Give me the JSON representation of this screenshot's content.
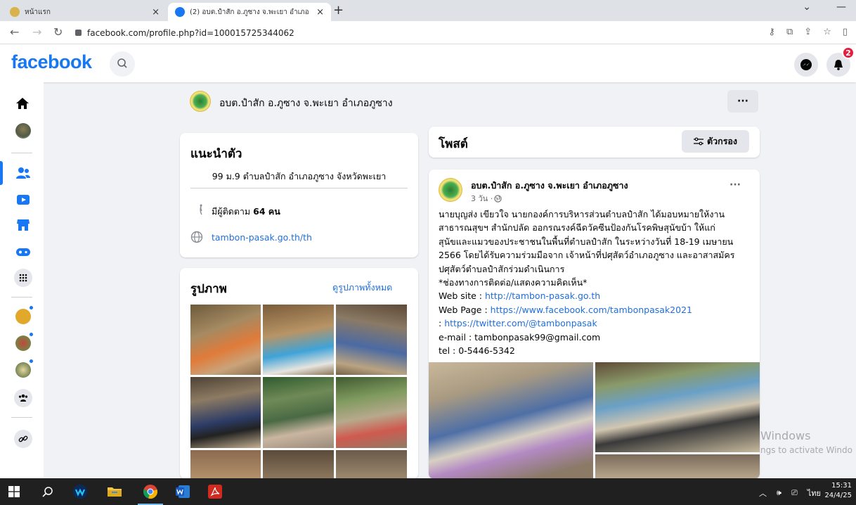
{
  "browser": {
    "tabs": [
      {
        "title": "หน้าแรก",
        "active": false,
        "favicon_color": "#d9b24c"
      },
      {
        "title": "(2) อบต.ปำสัก อ.ภูซาง จ.พะเยา อำเภอ",
        "active": true,
        "favicon_color": "#1877f2"
      }
    ],
    "new_tab": "+",
    "tab_close": "×",
    "url": "facebook.com/profile.php?id=100015725344062",
    "window_controls": [
      "⌄",
      "—"
    ]
  },
  "facebook": {
    "logo": "facebook",
    "notification_count": "2",
    "page_name": "อบต.ปำสัก อ.ภูซาง จ.พะเยา อำเภอภูซาง",
    "more_dots": "···",
    "intro": {
      "title": "แนะนำตัว",
      "address": "99 ม.9 ตำบลปำสัก อำเภอภูซาง จังหวัดพะเยา",
      "followers_prefix": "มีผู้ติดตาม",
      "followers_count": "64 คน",
      "website": "tambon-pasak.go.th/th"
    },
    "photos": {
      "title": "รูปภาพ",
      "see_all": "ดูรูปภาพทั้งหมด"
    },
    "posts": {
      "title": "โพสต์",
      "filter_label": "ตัวกรอง"
    },
    "post": {
      "author": "อบต.ปำสัก อ.ภูซาง จ.พะเยา อำเภอภูซาง",
      "time": "3 วัน ·",
      "lines": [
        "นายบุญส่ง เขียวใจ นายกองค์การบริหารส่วนตำบลปำสัก ได้มอบหมายให้งาน",
        "สาธารณสุขฯ สำนักปลัด ออกรณรงค์ฉีดวัคซีนป้องกันโรคพิษสุนัขบ้า ให้แก่",
        "สุนัขและแมวของประชาชนในพื้นที่ตำบลปำสัก ในระหว่างวันที่ 18-19 เมษายน",
        "2566 โดยได้รับความร่วมมือจาก เจ้าหน้าที่ปศุสัตว์อำเภอภูซาง และอาสาสมัคร",
        "ปศุสัตว์ตำบลปำสักร่วมดำเนินการ",
        "*ช่องทางการติดต่อ/แสดงความคิดเห็น*"
      ],
      "website_label": "Web site : ",
      "website_link": "http://tambon-pasak.go.th",
      "webpage_label": "Web Page : ",
      "webpage_link": "https://www.facebook.com/tambonpasak2021",
      "twitter_prefix": ": ",
      "twitter_link": "https://twitter.com/@tambonpasak",
      "email": "e-mail : tambonpasak99@gmail.com",
      "tel": "tel : 0-5446-5342"
    }
  },
  "watermark": {
    "line1": "Windows",
    "line2": "ngs to activate Windo"
  },
  "taskbar": {
    "lang": "ไทย",
    "time": "15:31",
    "date": "24/4/25"
  }
}
